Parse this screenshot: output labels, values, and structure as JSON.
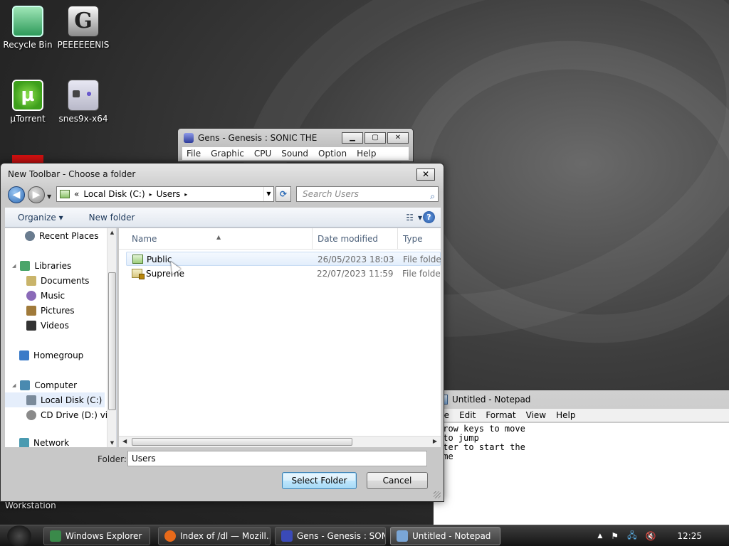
{
  "desktop": {
    "icons": [
      {
        "label": "Recycle Bin",
        "icon": "recycle-bin-icon"
      },
      {
        "label": "PEEEEEENIS",
        "icon": "gens-icon"
      },
      {
        "label": "µTorrent",
        "icon": "utorrent-icon"
      },
      {
        "label": "snes9x-x64",
        "icon": "gamepad-icon"
      }
    ],
    "workstation_label": "Workstation"
  },
  "gens_window": {
    "title": "Gens - Genesis : SONIC THE",
    "menu": [
      "File",
      "Graphic",
      "CPU",
      "Sound",
      "Option",
      "Help"
    ],
    "buttons": {
      "minimize": "▁",
      "maximize": "▢",
      "close": "✕"
    }
  },
  "notepad": {
    "title": "Untitled - Notepad",
    "menu": [
      "ile",
      "Edit",
      "Format",
      "View",
      "Help"
    ],
    "text": "rrow keys to move\n to jump\nnter to start the\name"
  },
  "dialog": {
    "title": "New Toolbar - Choose a folder",
    "close": "✕",
    "address": {
      "prefix": "«",
      "parts": [
        "Local Disk (C:)",
        "Users"
      ],
      "sep": "▸"
    },
    "search_placeholder": "Search Users",
    "toolbar": {
      "organize": "Organize ▾",
      "new_folder": "New folder",
      "view": "▾",
      "help": "?"
    },
    "nav": [
      {
        "label": "Recent Places",
        "icon": "recent-places-icon",
        "color": "#6a7c8f"
      },
      {
        "label": "Libraries",
        "icon": "libraries-icon",
        "color": "#4aa56a"
      },
      {
        "label": "Documents",
        "icon": "documents-icon",
        "color": "#c9b46a"
      },
      {
        "label": "Music",
        "icon": "music-icon",
        "color": "#8a6ab8"
      },
      {
        "label": "Pictures",
        "icon": "pictures-icon",
        "color": "#a07a3a"
      },
      {
        "label": "Videos",
        "icon": "videos-icon",
        "color": "#333333"
      },
      {
        "label": "Homegroup",
        "icon": "homegroup-icon",
        "color": "#3a7ac8"
      },
      {
        "label": "Computer",
        "icon": "computer-icon",
        "color": "#4a8ab0"
      },
      {
        "label": "Local Disk (C:)",
        "icon": "local-disk-icon",
        "color": "#7a8a9a"
      },
      {
        "label": "CD Drive (D:) virt",
        "icon": "cd-drive-icon",
        "color": "#8a8a8a"
      },
      {
        "label": "Network",
        "icon": "network-icon",
        "color": "#4a9ab0"
      }
    ],
    "columns": {
      "name": "Name",
      "date": "Date modified",
      "type": "Type"
    },
    "rows": [
      {
        "name": "Public",
        "date": "26/05/2023 18:03",
        "type": "File folder"
      },
      {
        "name": "Supreme",
        "date": "22/07/2023 11:59",
        "type": "File folder"
      }
    ],
    "folder_label": "Folder:",
    "folder_value": "Users",
    "select_button": "Select Folder",
    "cancel_button": "Cancel"
  },
  "taskbar": {
    "items": [
      {
        "label": "Windows Explorer",
        "color": "#3a8a4a"
      },
      {
        "label": "Index of /dl — Mozill...",
        "color": "#e86a1a"
      },
      {
        "label": "Gens - Genesis : SON...",
        "color": "#3a4ab8"
      },
      {
        "label": "Untitled - Notepad",
        "color": "#7aa6d6"
      }
    ],
    "clock": "12:25",
    "tray_icons": [
      "show-hidden-icon",
      "action-center-flag-icon",
      "network-icon",
      "volume-muted-icon"
    ],
    "tray_glyphs": [
      "▲",
      "⚑",
      "🖧",
      "🔇"
    ]
  }
}
